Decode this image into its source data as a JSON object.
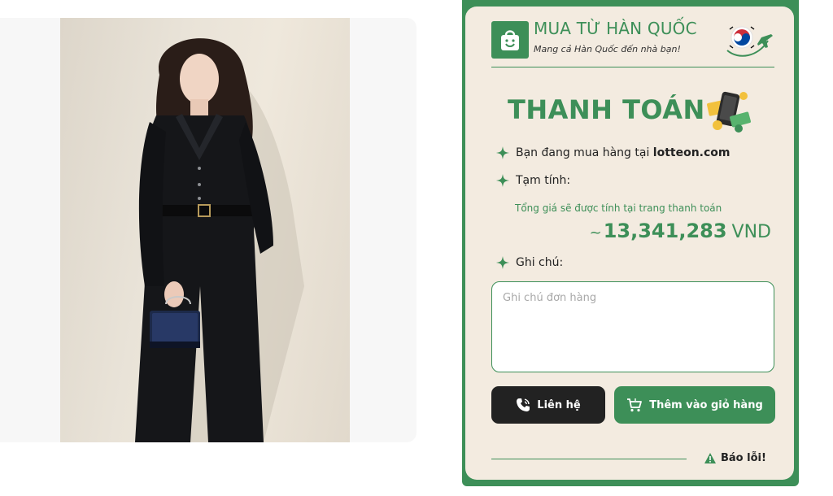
{
  "brand": {
    "title": "MUA TỪ HÀN QUỐC",
    "subtitle": "Mang cả Hàn Quốc đến nhà bạn!"
  },
  "payment": {
    "title": "THANH TOÁN",
    "shop_prefix": "Bạn đang mua hàng tại",
    "shop_site": "lotteon.com",
    "subtotal_label": "Tạm tính:",
    "subtotal_note": "Tổng giá sẽ được tính tại trang thanh toán",
    "approx_symbol": "~",
    "amount": "13,341,283",
    "currency": "VND",
    "note_label": "Ghi chú:",
    "note_placeholder": "Ghi chú đơn hàng",
    "note_value": ""
  },
  "actions": {
    "contact_label": "Liên hệ",
    "add_to_cart_label": "Thêm vào giỏ hàng",
    "report_label": "Báo lỗi!"
  },
  "colors": {
    "brand_green": "#3d8f58",
    "panel_bg": "#f3ebe0",
    "dark_button": "#222222"
  },
  "icons": [
    "shopping-bag-icon",
    "korea-flag-plane-icon",
    "payment-phone-money-icon",
    "sparkle-icon",
    "phone-icon",
    "cart-icon",
    "warning-icon"
  ]
}
